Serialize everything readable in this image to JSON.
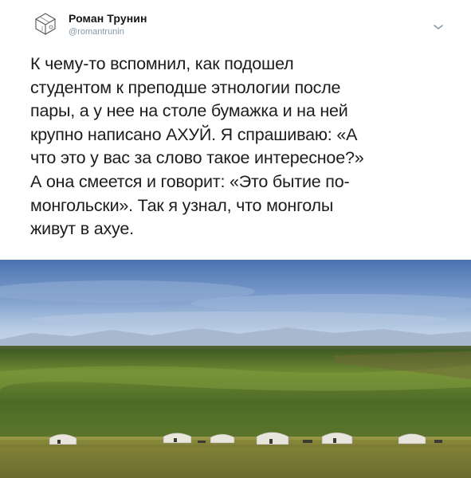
{
  "author": {
    "display_name": "Роман Трунин",
    "handle": "@romantrunin"
  },
  "icons": {
    "avatar": "pencil-sketch-avatar-icon",
    "menu": "chevron-down-icon"
  },
  "tweet": {
    "lines": [
      "К чему-то вспомнил, как подошел",
      "студентом к преподше этнологии после",
      "пары, а у нее на столе бумажка и на ней",
      "крупно написано АХУЙ. Я спрашиваю: «А",
      "что это у вас за слово такое интересное?»",
      "А она смеется и говорит: «Это бытие по-",
      "монгольски». Так я узнал, что монголы",
      "живут в ахуе."
    ]
  },
  "colors": {
    "name_text": "#14171a",
    "handle_text": "#8899a6",
    "sky_top": "#4f78b5",
    "steppe_green": "#5f7a2c"
  }
}
